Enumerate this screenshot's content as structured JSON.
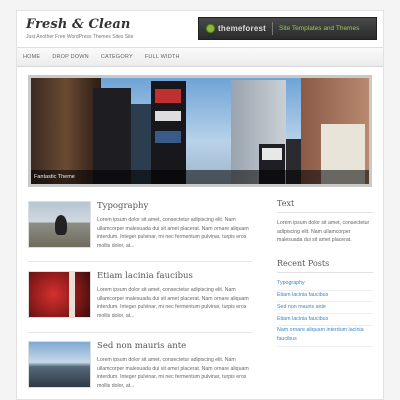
{
  "header": {
    "logo": "Fresh & Clean",
    "tagline": "Just Another Free WordPress Themes Sites Site",
    "banner": {
      "brand": "themeforest",
      "text": "Site Templates and Themes"
    }
  },
  "nav": [
    "HOME",
    "DROP DOWN",
    "CATEGORY",
    "FULL WIDTH"
  ],
  "slider": {
    "caption": "Fantastic Theme"
  },
  "posts": [
    {
      "title": "Typography",
      "excerpt": "Lorem ipsum dolor sit amet, consectetur adipiscing elit. Nam ullamcorper malesuada dui sit amet placerat. Nam ornare aliquam interdum. Integer pulvinar, mi nec fermentum pulvinar, turpis eros mollis dolor, at..."
    },
    {
      "title": "Etiam lacinia faucibus",
      "excerpt": "Lorem ipsum dolor sit amet, consectetur adipiscing elit. Nam ullamcorper malesuada dui sit amet placerat. Nam ornare aliquam interdum. Integer pulvinar, mi nec fermentum pulvinar, turpis eros mollis dolor, at..."
    },
    {
      "title": "Sed non mauris ante",
      "excerpt": "Lorem ipsum dolor sit amet, consectetur adipiscing elit. Nam ullamcorper malesuada dui sit amet placerat. Nam ornare aliquam interdum. Integer pulvinar, mi nec fermentum pulvinar, turpis eros mollis dolor, at..."
    }
  ],
  "sidebar": {
    "text_widget": {
      "title": "Text",
      "body": "Lorem ipsum dolor sit amet, consectetur adipiscing elit. Nam ullamcorper malesuada dui sit amet placerat."
    },
    "recent_posts": {
      "title": "Recent Posts",
      "items": [
        "Typography",
        "Etiam lacinia faucibus",
        "Sed non mauris ante",
        "Etiam lacinia faucibus",
        "Nam ornare aliquam interdum lacinia faucibus"
      ]
    }
  },
  "colors": {
    "link": "#3c87c8",
    "banner_accent": "#9bc860",
    "caption_bg": "#000000"
  }
}
